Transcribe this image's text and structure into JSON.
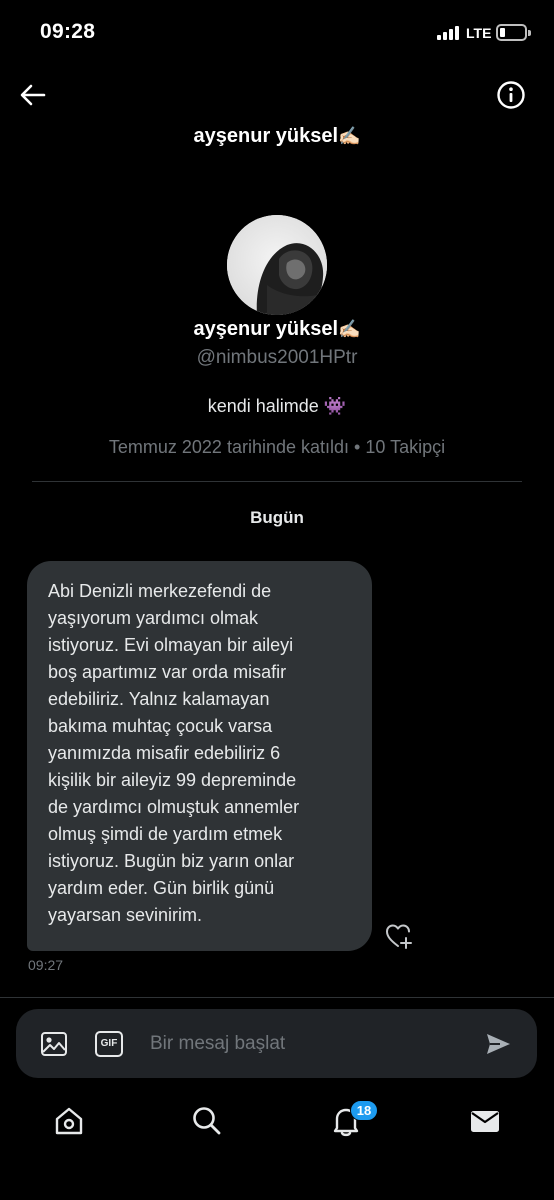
{
  "status_bar": {
    "time": "09:28",
    "network": "LTE",
    "battery_level": 0.2
  },
  "header": {
    "title": "ayşenur yüksel",
    "title_emoji": "✍🏻",
    "back_icon": "arrow-left-icon",
    "info_icon": "info-icon"
  },
  "profile": {
    "name": "ayşenur yüksel",
    "name_emoji": "✍🏻",
    "handle": "@nimbus2001HPtr",
    "bio": "kendi halimde",
    "bio_emoji": "👾",
    "joined": "Temmuz 2022 tarihinde katıldı",
    "separator": "•",
    "followers": "10 Takipçi"
  },
  "conversation": {
    "date_label": "Bugün",
    "messages": [
      {
        "text": "Abi Denizli merkezefendi de\nyaşıyorum yardımcı olmak\nistiyoruz. Evi olmayan bir aileyi\nboş apartımız var orda misafir\nedebiliriz. Yalnız kalamayan\nbakıma muhtaç çocuk varsa\nyanımızda misafir edebiliriz 6\nkişilik bir aileyiz 99 depreminde\nde yardımcı olmuştuk annemler\nolmuş şimdi de yardım etmek\nistiyoruz. Bugün biz yarın onlar\nyardım eder. Gün birlik günü\nyayarsan sevinirim.",
        "time": "09:27"
      }
    ]
  },
  "composer": {
    "placeholder": "Bir mesaj başlat",
    "gif_label": "GIF"
  },
  "bottom_nav": {
    "items": [
      "home-icon",
      "search-icon",
      "notifications-icon",
      "messages-icon"
    ],
    "notification_count": "18"
  },
  "colors": {
    "background": "#000000",
    "bubble": "#2f3336",
    "accent": "#1d9bf0",
    "secondary_text": "#71767b"
  }
}
